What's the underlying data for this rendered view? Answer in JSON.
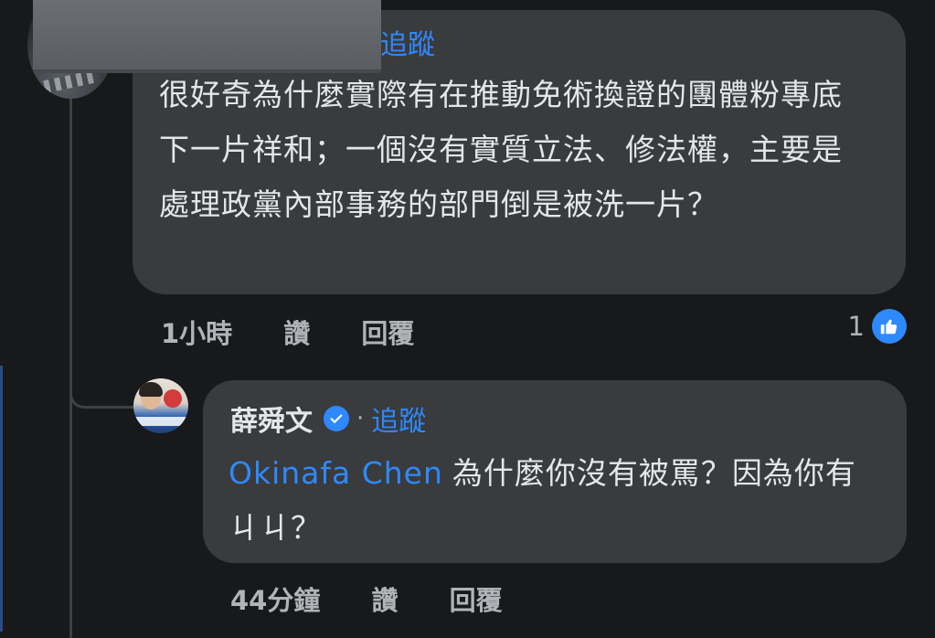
{
  "comment": {
    "follow_label": "追蹤",
    "text": "很好奇為什麼實際有在推動免術換證的團體粉專底下一片祥和；一個沒有實質立法、修法權，主要是處理政黨內部事務的部門倒是被洗一片？",
    "time": "1小時",
    "like_label": "讚",
    "reply_label": "回覆",
    "reaction_count": "1",
    "reaction_icon": "thumbs-up-icon"
  },
  "reply": {
    "author": "薛舜文",
    "verified_icon": "verified-badge-icon",
    "separator": "·",
    "follow_label": "追蹤",
    "mention": "Okinafa Chen",
    "text": "為什麼你沒有被罵？因為你有ㄐㄐ？",
    "time": "44分鐘",
    "like_label": "讚",
    "reply_label": "回覆"
  },
  "colors": {
    "background": "#18191a",
    "bubble": "#3a3b3c",
    "text": "#e4e6eb",
    "meta_text": "#b0b3b8",
    "accent": "#2e89ff"
  }
}
